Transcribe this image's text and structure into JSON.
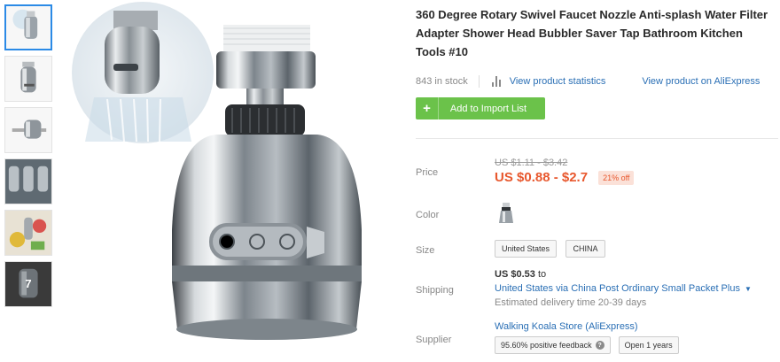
{
  "thumbnails": {
    "more_count": "7"
  },
  "product": {
    "title": "360 Degree Rotary Swivel Faucet Nozzle Anti-splash Water Filter Adapter Shower Head Bubbler Saver Tap Bathroom Kitchen Tools #10",
    "stock": "843 in stock",
    "stats_link": "View product statistics",
    "aliexpress_link": "View product on AliExpress",
    "add_button": "Add to Import List",
    "add_icon": "+"
  },
  "price": {
    "label": "Price",
    "original": "US $1.11 - $3.42",
    "current": "US $0.88 - $2.7",
    "discount": "21% off"
  },
  "color": {
    "label": "Color",
    "swatch_icon": "faucet-swatch-icon"
  },
  "size": {
    "label": "Size",
    "options": [
      "United States",
      "CHINA"
    ]
  },
  "shipping": {
    "label": "Shipping",
    "price": "US $0.53",
    "price_suffix": "to",
    "method": "United States via China Post Ordinary Small Packet Plus",
    "estimate": "Estimated delivery time 20-39 days"
  },
  "supplier": {
    "label": "Supplier",
    "store": "Walking Koala Store (AliExpress)",
    "feedback": "95.60% positive feedback",
    "help_icon": "?",
    "open": "Open 1 years"
  },
  "colors": {
    "accent_green": "#6bc24a",
    "link_blue": "#2a6fb5",
    "price_orange": "#e8582e",
    "selected_thumb": "#2b8ae6"
  }
}
